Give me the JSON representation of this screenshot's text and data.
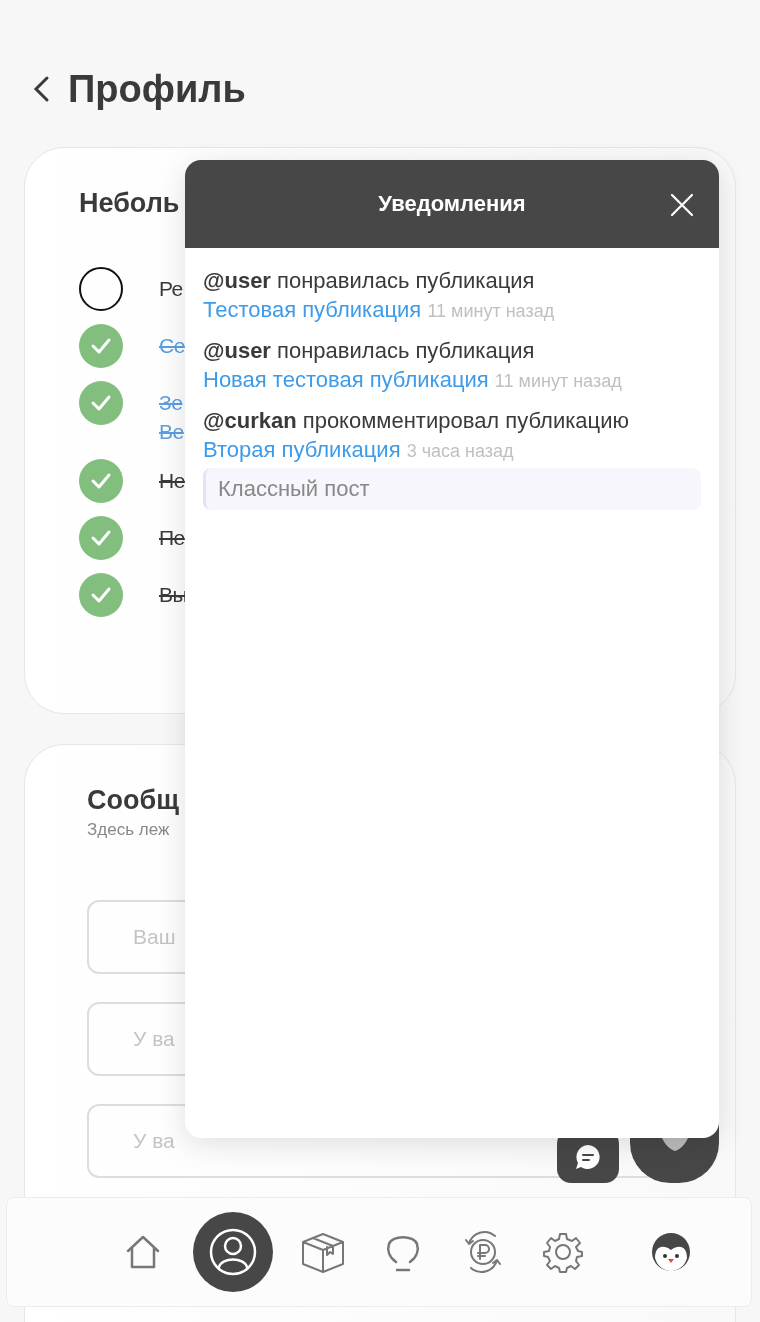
{
  "page": {
    "title": "Профиль"
  },
  "checklist": {
    "title": "Неболь",
    "items": [
      {
        "lines": [
          "Ре"
        ],
        "done": false,
        "kind": "text"
      },
      {
        "lines": [
          "Се"
        ],
        "done": true,
        "kind": "link"
      },
      {
        "lines": [
          "Зе",
          "Ве"
        ],
        "done": true,
        "kind": "link"
      },
      {
        "lines": [
          "Не"
        ],
        "done": true,
        "kind": "text"
      },
      {
        "lines": [
          "Пе"
        ],
        "done": true,
        "kind": "text"
      },
      {
        "lines": [
          "Вы"
        ],
        "done": true,
        "kind": "text"
      }
    ]
  },
  "messages": {
    "title": "Сообщ",
    "subtitle": "Здесь леж",
    "fields": [
      {
        "placeholder": "Ваш"
      },
      {
        "placeholder": "У ва"
      },
      {
        "placeholder": "У ва"
      }
    ]
  },
  "notifications": {
    "title": "Уведомления",
    "items": [
      {
        "user": "@user",
        "action": "понравилась публикация",
        "post": "Тестовая публикация",
        "time": "11 минут назад"
      },
      {
        "user": "@user",
        "action": "понравилась публикация",
        "post": "Новая тестовая публикация",
        "time": "11 минут назад"
      },
      {
        "user": "@curkan",
        "action": "прокомментировал публикацию",
        "post": "Вторая публикация",
        "time": "3 часа назад",
        "comment": "Классный пост"
      }
    ]
  },
  "nav": {
    "items": [
      {
        "kind": "home",
        "selected": false
      },
      {
        "kind": "profile",
        "selected": true
      },
      {
        "kind": "box",
        "selected": false
      },
      {
        "kind": "bulb",
        "selected": false
      },
      {
        "kind": "ruble",
        "selected": false
      },
      {
        "kind": "settings",
        "selected": false
      },
      {
        "kind": "avatar",
        "selected": false
      }
    ]
  }
}
